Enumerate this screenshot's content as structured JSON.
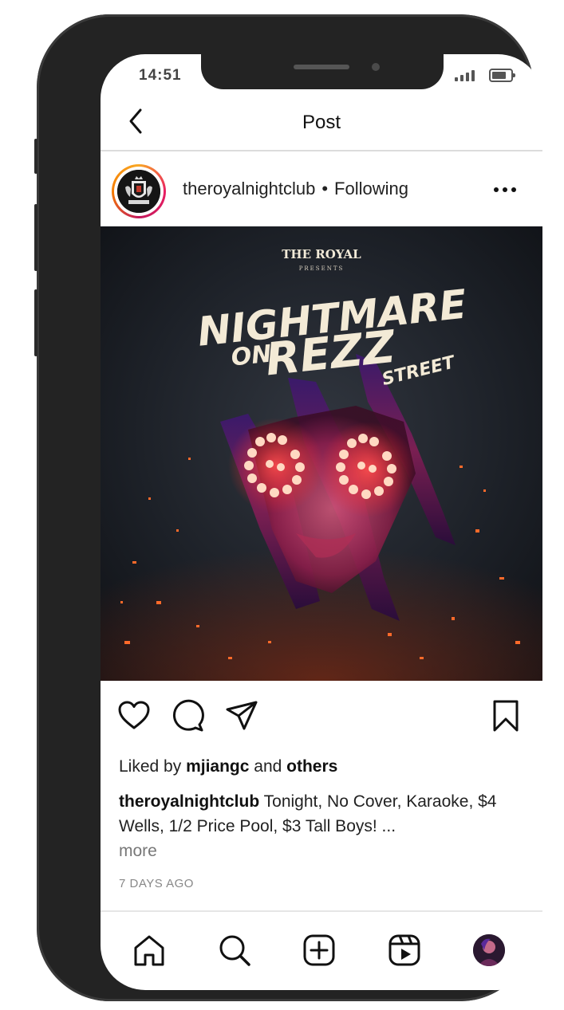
{
  "status_bar": {
    "time": "14:51"
  },
  "header": {
    "title": "Post",
    "back_icon": "chevron-left-icon"
  },
  "post": {
    "username": "theroyalnightclub",
    "separator": "•",
    "follow_state": "Following",
    "more_icon": "more-horizontal-icon",
    "image": {
      "brand": "THE ROYAL",
      "presents": "PRESENTS",
      "title_line1": "NIGHTMARE",
      "title_on": "ON",
      "title_rezz": "REZZ",
      "title_street": "STREET"
    },
    "likes": {
      "prefix": "Liked by",
      "user": "mjiangc",
      "conjunction": "and",
      "others": "others"
    },
    "caption": {
      "author": "theroyalnightclub",
      "text": " Tonight, No Cover, Karaoke, $4 Wells, 1/2 Price Pool, $3 Tall Boys! ...",
      "more": "more"
    },
    "timestamp": "7 DAYS AGO"
  },
  "actions": [
    "heart-icon",
    "comment-icon",
    "share-icon",
    "bookmark-icon"
  ],
  "bottom_nav": [
    "home-icon",
    "search-icon",
    "add-post-icon",
    "reels-icon",
    "profile-avatar"
  ]
}
